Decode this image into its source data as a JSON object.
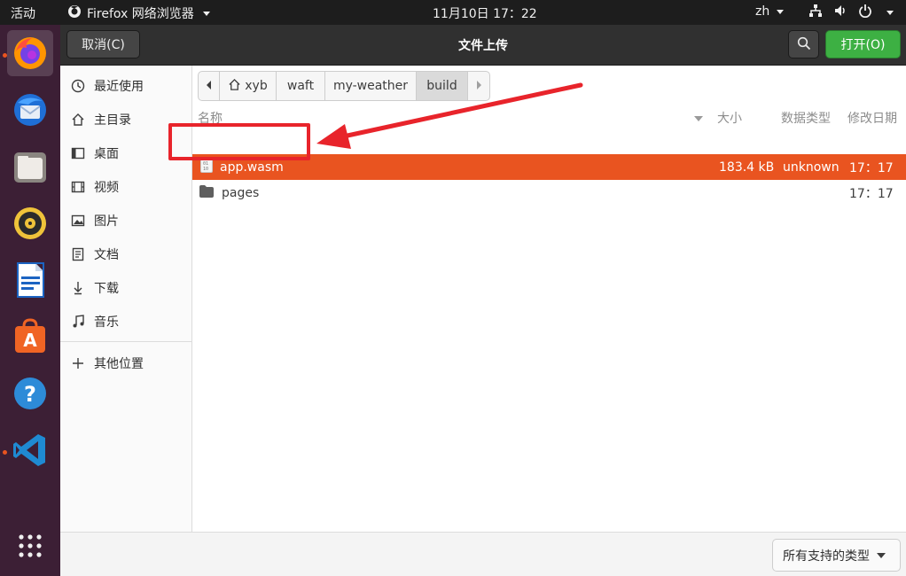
{
  "topbar": {
    "activities": "活动",
    "app_name": "Firefox 网络浏览器",
    "clock": "11月10日  17：22",
    "lang": "zh",
    "tray_icons": [
      "network-icon",
      "volume-icon",
      "power-icon"
    ]
  },
  "dock": {
    "items": [
      "firefox",
      "thunderbird",
      "files",
      "rhythmbox",
      "libreoffice-writer",
      "ubuntu-software",
      "help",
      "vscode",
      "show-applications"
    ]
  },
  "dialog": {
    "title": "文件上传",
    "cancel_label": "取消(C)",
    "open_label": "打开(O)"
  },
  "sidebar": {
    "items": [
      {
        "label": "最近使用",
        "icon": "clock-icon"
      },
      {
        "label": "主目录",
        "icon": "home-icon"
      },
      {
        "label": "桌面",
        "icon": "desktop-icon"
      },
      {
        "label": "视频",
        "icon": "video-icon"
      },
      {
        "label": "图片",
        "icon": "picture-icon"
      },
      {
        "label": "文档",
        "icon": "document-icon"
      },
      {
        "label": "下载",
        "icon": "download-icon"
      },
      {
        "label": "音乐",
        "icon": "music-icon"
      }
    ],
    "other_locations": "其他位置"
  },
  "pathbar": {
    "crumbs": [
      "xyb",
      "waft",
      "my-weather",
      "build"
    ],
    "active": "build"
  },
  "filelist": {
    "columns": [
      "名称",
      "大小",
      "数据类型",
      "修改日期"
    ],
    "rows": [
      {
        "name": "app.wasm",
        "size": "183.4 kB",
        "type": "unknown",
        "modified": "17：17",
        "selected": true
      },
      {
        "name": "pages",
        "size": "",
        "type": "",
        "modified": "17：17",
        "selected": false
      }
    ]
  },
  "filter": {
    "selected": "所有支持的类型"
  },
  "colors": {
    "selection": "#e95420",
    "open_button": "#3db043",
    "annotation": "#e8242b",
    "dock_bg": "#3c1f35"
  }
}
